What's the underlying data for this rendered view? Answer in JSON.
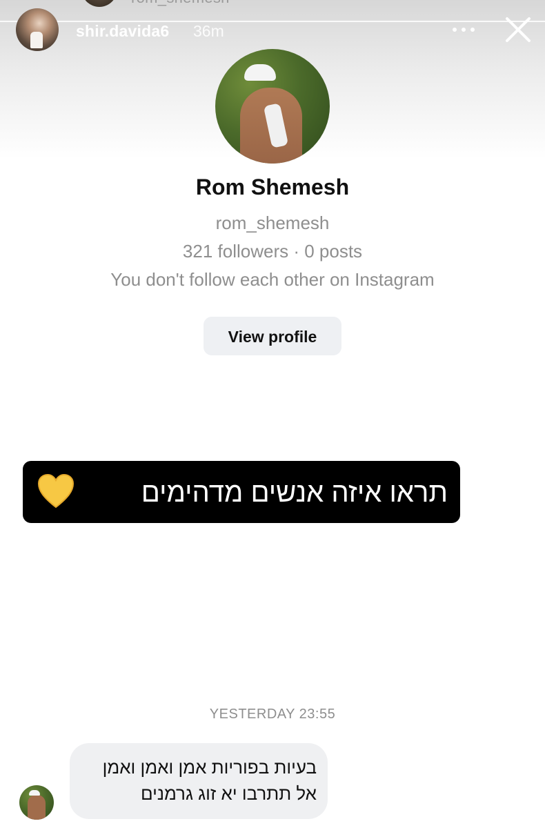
{
  "story": {
    "previous_username": "rom_shemesh",
    "username": "shir.davida6",
    "time_ago": "36m",
    "more_icon": "more-horizontal-icon",
    "close_icon": "close-icon"
  },
  "profile_card": {
    "name": "Rom Shemesh",
    "handle": "rom_shemesh",
    "stats": "321 followers · 0 posts",
    "relation": "You don't follow each other on Instagram",
    "view_profile_label": "View profile"
  },
  "sticker": {
    "text": "תראו איזה אנשים מדהימים",
    "emoji": "yellow-heart-icon",
    "color": "#000000"
  },
  "chat": {
    "timestamp": "YESTERDAY 23:55",
    "message_line_1": "בעיות בפוריות אמן ואמן ואמן",
    "message_line_2": "אל תתרבו יא זוג גרמנים",
    "bubble_color": "#eff0f2"
  }
}
